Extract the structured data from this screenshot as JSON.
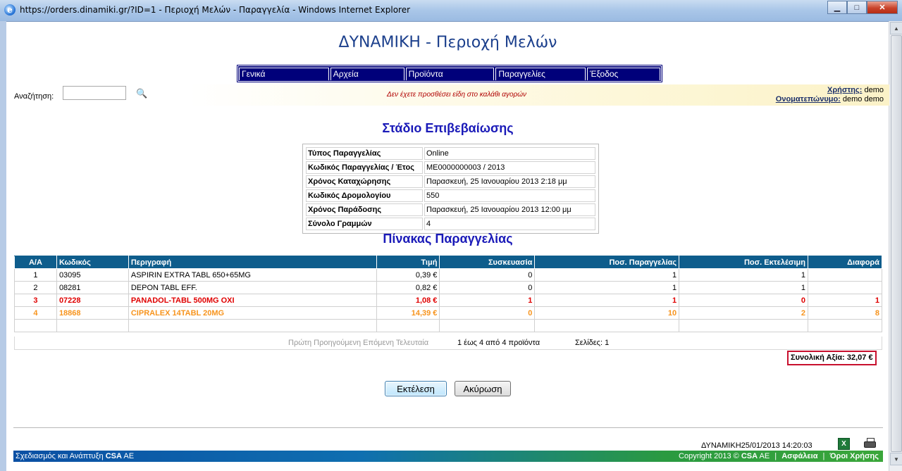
{
  "window": {
    "title": "https://orders.dinamiki.gr/?ID=1 - Περιοχή Μελών - Παραγγελία - Windows Internet Explorer",
    "minimize": "▁",
    "maximize": "□",
    "close": "✕"
  },
  "site_title": "ΔΥΝΑΜΙΚΗ - Περιοχή Μελών",
  "menu": [
    {
      "label": "Γενικά"
    },
    {
      "label": "Αρχεία"
    },
    {
      "label": "Προϊόντα"
    },
    {
      "label": "Παραγγελίες"
    },
    {
      "label": "Έξοδος"
    }
  ],
  "search": {
    "label": "Αναζήτηση:",
    "value": "",
    "cart_message": "Δεν έχετε προσθέσει είδη στο καλάθι αγορών"
  },
  "user": {
    "user_label": "Χρήστης:",
    "user_value": "demo",
    "name_label": "Ονοματεπώνυμο:",
    "name_value": "demo demo"
  },
  "stage_title": "Στάδιο Επιβεβαίωσης",
  "order_info": [
    {
      "key": "Τύπος Παραγγελίας",
      "value": "Online"
    },
    {
      "key": "Κωδικός Παραγγελίας / Έτος",
      "value": "ΜΕ0000000003 / 2013"
    },
    {
      "key": "Χρόνος Καταχώρησης",
      "value": "Παρασκευή, 25 Ιανουαρίου 2013 2:18 μμ"
    },
    {
      "key": "Κωδικός Δρομολογίου",
      "value": "550"
    },
    {
      "key": "Χρόνος Παράδοσης",
      "value": "Παρασκευή, 25 Ιανουαρίου 2013 12:00 μμ"
    },
    {
      "key": "Σύνολο Γραμμών",
      "value": "4"
    }
  ],
  "table_title": "Πίνακας Παραγγελίας",
  "columns": [
    "Α/Α",
    "Κωδικός",
    "Περιγραφή",
    "Τιμή",
    "Συσκευασία",
    "Ποσ. Παραγγελίας",
    "Ποσ. Εκτελέσιμη",
    "Διαφορά"
  ],
  "rows": [
    {
      "aa": "1",
      "code": "03095",
      "desc": "ASPIRIN EXTRA TABL 650+65MG",
      "price": "0,39 €",
      "pack": "0",
      "qty_order": "1",
      "qty_exec": "1",
      "diff": ""
    },
    {
      "aa": "2",
      "code": "08281",
      "desc": "DEPON TABL EFF.",
      "price": "0,82 €",
      "pack": "0",
      "qty_order": "1",
      "qty_exec": "1",
      "diff": ""
    },
    {
      "aa": "3",
      "code": "07228",
      "desc": "PANADOL-TABL 500MG OXI",
      "price": "1,08 €",
      "pack": "1",
      "qty_order": "1",
      "qty_exec": "0",
      "diff": "1"
    },
    {
      "aa": "4",
      "code": "18868",
      "desc": "CIPRALEX 14TABL 20MG",
      "price": "14,39 €",
      "pack": "0",
      "qty_order": "10",
      "qty_exec": "2",
      "diff": "8"
    }
  ],
  "pager": {
    "nav": "Πρώτη Προηγούμενη Επόμενη Τελευταία",
    "count": "1 έως 4 από 4 προϊόντα",
    "pages": "Σελίδες: 1"
  },
  "total": "Συνολική Αξία: 32,07 €",
  "buttons": {
    "execute": "Εκτέλεση",
    "cancel": "Ακύρωση"
  },
  "footer": {
    "stamp": "ΔΥΝΑΜΙΚΗ25/01/2013 14:20:03",
    "left_text": "Σχεδιασμός και Ανάπτυξη",
    "left_brand": "CSA",
    "left_suffix": "AE",
    "copyright": "Copyright 2013 ©",
    "right_brand": "CSA",
    "right_suffix": "AE",
    "security": "Ασφάλεια",
    "terms": "Όροι Χρήσης",
    "divider": "|"
  },
  "icons": {
    "excel": "excel-export-icon",
    "print": "printer-icon",
    "search": "binoculars-icon",
    "ie": "internet-explorer-icon"
  }
}
